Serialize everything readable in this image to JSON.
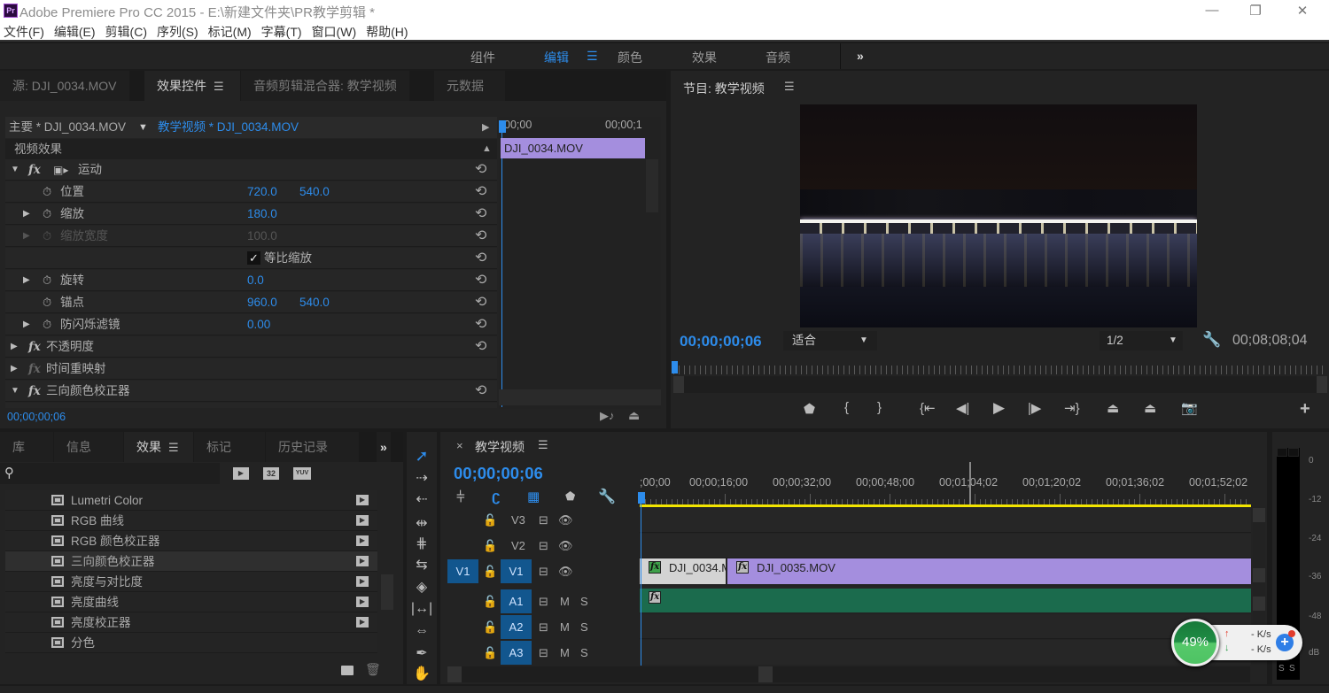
{
  "window": {
    "app_icon": "Pr",
    "title": "Adobe Premiere Pro CC 2015 - E:\\新建文件夹\\PR教学剪辑 *",
    "controls": {
      "minimize": "—",
      "restore": "❐",
      "close": "✕"
    }
  },
  "menu": [
    "文件(F)",
    "编辑(E)",
    "剪辑(C)",
    "序列(S)",
    "标记(M)",
    "字幕(T)",
    "窗口(W)",
    "帮助(H)"
  ],
  "workspaces": {
    "items": [
      "组件",
      "编辑",
      "颜色",
      "效果",
      "音频"
    ],
    "active": "编辑",
    "more": "»"
  },
  "source_panel": {
    "tabs": [
      "源: DJI_0034.MOV",
      "效果控件",
      "音频剪辑混合器: 教学视频",
      "元数据"
    ],
    "active_tab": "效果控件",
    "master_clip": "主要 * DJI_0034.MOV",
    "sequence_clip": "教学视频 * DJI_0034.MOV",
    "mini_timeline": {
      "start": "00;00",
      "end": "00;00;1",
      "clip": "DJI_0034.MOV"
    },
    "section_header": "视频效果",
    "effects": [
      {
        "kind": "fx",
        "expanded": true,
        "name": "运动",
        "reset": true
      },
      {
        "kind": "param",
        "name": "位置",
        "values": [
          "720.0",
          "540.0"
        ],
        "expandable": false
      },
      {
        "kind": "param",
        "name": "缩放",
        "values": [
          "180.0"
        ],
        "expandable": true
      },
      {
        "kind": "param",
        "name": "缩放宽度",
        "values": [
          "100.0"
        ],
        "expandable": true,
        "disabled": true
      },
      {
        "kind": "checkbox",
        "name": "等比缩放",
        "checked": true
      },
      {
        "kind": "param",
        "name": "旋转",
        "values": [
          "0.0"
        ],
        "expandable": true
      },
      {
        "kind": "param",
        "name": "锚点",
        "values": [
          "960.0",
          "540.0"
        ],
        "expandable": false
      },
      {
        "kind": "param",
        "name": "防闪烁滤镜",
        "values": [
          "0.00"
        ],
        "expandable": true
      },
      {
        "kind": "fx",
        "expanded": false,
        "name": "不透明度",
        "reset": true
      },
      {
        "kind": "fx",
        "expanded": false,
        "name": "时间重映射",
        "reset": false,
        "dim_fx": true
      },
      {
        "kind": "fx",
        "expanded": true,
        "name": "三向颜色校正器",
        "reset": true
      }
    ],
    "timecode": "00;00;00;06"
  },
  "program_monitor": {
    "title": "节目: 教学视频",
    "current_time": "00;00;00;06",
    "zoom": "适合",
    "resolution": "1/2",
    "duration": "00;08;08;04",
    "preview_description": "night city skyline with illuminated bridge reflecting on river"
  },
  "effects_panel": {
    "tabs": [
      "库",
      "信息",
      "效果",
      "标记",
      "历史记录"
    ],
    "active_tab": "效果",
    "more": "»",
    "search_placeholder": "",
    "filter_badges": [
      "accelerated",
      "32",
      "YUV"
    ],
    "items": [
      {
        "name": "Lumetri Color",
        "accelerated": true
      },
      {
        "name": "RGB 曲线",
        "accelerated": true
      },
      {
        "name": "RGB 颜色校正器",
        "accelerated": true
      },
      {
        "name": "三向颜色校正器",
        "accelerated": true,
        "selected": true
      },
      {
        "name": "亮度与对比度",
        "accelerated": true
      },
      {
        "name": "亮度曲线",
        "accelerated": true
      },
      {
        "name": "亮度校正器",
        "accelerated": true
      },
      {
        "name": "分色",
        "accelerated": false
      }
    ]
  },
  "timeline": {
    "sequence_name": "教学视频",
    "timecode": "00;00;00;06",
    "ruler": [
      ";00;00",
      "00;00;16;00",
      "00;00;32;00",
      "00;00;48;00",
      "00;01;04;02",
      "00;01;20;02",
      "00;01;36;02",
      "00;01;52;02"
    ],
    "video_tracks": [
      {
        "name": "V3",
        "source_target": ""
      },
      {
        "name": "V2",
        "source_target": ""
      },
      {
        "name": "V1",
        "source_target": "V1"
      }
    ],
    "audio_tracks": [
      {
        "name": "A1",
        "m": "M",
        "s": "S"
      },
      {
        "name": "A2",
        "m": "M",
        "s": "S"
      },
      {
        "name": "A3",
        "m": "M",
        "s": "S"
      }
    ],
    "clips": {
      "v1": [
        {
          "name": "DJI_0034.M",
          "style": "selected"
        },
        {
          "name": "DJI_0035.MOV",
          "style": "video"
        }
      ],
      "a1": [
        {
          "name": "fx",
          "style": "audio"
        }
      ]
    }
  },
  "audio_meter": {
    "scale": [
      "0",
      "-12",
      "-24",
      "-36",
      "-48",
      "dB"
    ],
    "solo": [
      "S",
      "S"
    ]
  },
  "network_widget": {
    "percent": "49%",
    "up": "- K/s",
    "down": "- K/s"
  },
  "colors": {
    "accent_blue": "#2d8ceb",
    "video_clip": "#a48ede",
    "audio_clip": "#1b6b4d",
    "target_track": "#12568e",
    "work_area": "#f2e400"
  }
}
